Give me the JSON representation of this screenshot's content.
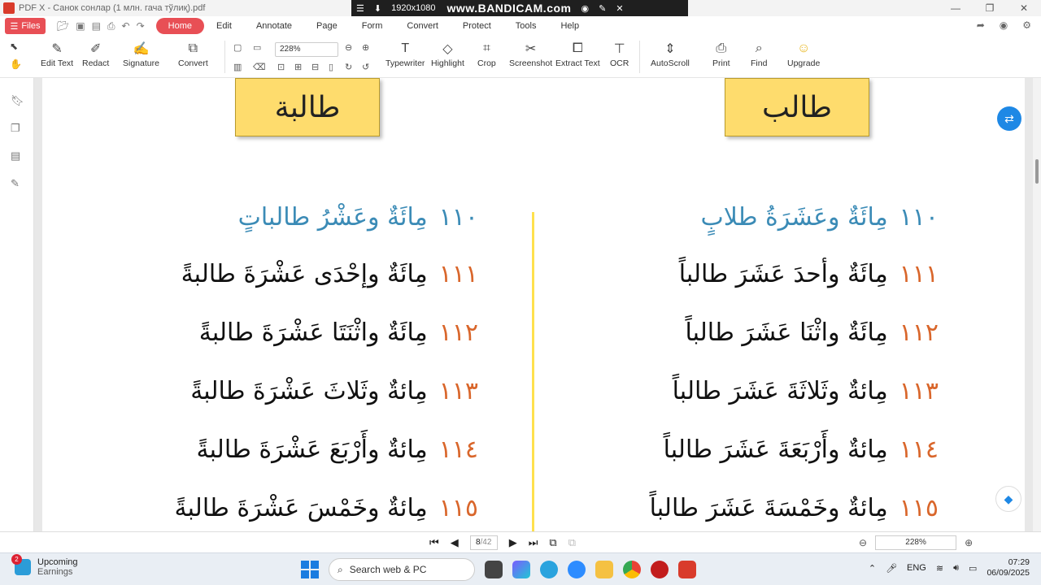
{
  "window": {
    "title": "PDF X - Санок сонлар (1 млн. гача тўлиқ).pdf"
  },
  "recorder": {
    "resolution": "1920x1080",
    "brand": "www.BANDICAM.com"
  },
  "menubar": {
    "files_label": "Files",
    "items": [
      "Home",
      "Edit",
      "Annotate",
      "Page",
      "Form",
      "Convert",
      "Protect",
      "Tools",
      "Help"
    ]
  },
  "toolbar": {
    "zoom": "228%",
    "tools": [
      "Edit Text",
      "Redact",
      "Signature",
      "Convert",
      "Typewriter",
      "Highlight",
      "Crop",
      "Screenshot",
      "Extract Text",
      "OCR",
      "AutoScroll",
      "Print",
      "Find",
      "Upgrade"
    ]
  },
  "document": {
    "left_title": "طالبة",
    "right_title": "طالب",
    "left_header": {
      "num": "١١٠",
      "text": "مِائَةٌ وعَشْرُ طالباتٍ"
    },
    "right_header": {
      "num": "١١٠",
      "text": "مِائَةٌ وعَشَرَةُ طلابٍ"
    },
    "left_lines": [
      {
        "num": "١١١",
        "text": "مِائَةٌ وإحْدَى عَشْرَةَ طالبةً"
      },
      {
        "num": "١١٢",
        "text": "مِائَةٌ واثْنَتَا عَشْرَةَ طالبةً"
      },
      {
        "num": "١١٣",
        "text": "مِائةٌ وثَلاثَ عَشْرَةَ طالبةً"
      },
      {
        "num": "١١٤",
        "text": "مِائةٌ وأَرْبَعَ عَشْرَةَ طالبةً"
      },
      {
        "num": "١١٥",
        "text": "مِائةٌ وخَمْسَ عَشْرَةَ طالبةً"
      }
    ],
    "right_lines": [
      {
        "num": "١١١",
        "text": "مِائَةٌ وأحدَ عَشَرَ طالباً"
      },
      {
        "num": "١١٢",
        "text": "مِائَةٌ واثْنَا عَشَرَ طالباً"
      },
      {
        "num": "١١٣",
        "text": "مِائةٌ وثَلاثَةَ عَشَرَ طالباً"
      },
      {
        "num": "١١٤",
        "text": "مِائةٌ وأَرْبَعَةَ عَشَرَ طالباً"
      },
      {
        "num": "١١٥",
        "text": "مِائةٌ وخَمْسَةَ عَشَرَ طالباً"
      }
    ]
  },
  "statusbar": {
    "page_current": "8",
    "page_total": "/42",
    "zoom": "228%"
  },
  "taskbar": {
    "weather_title": "Upcoming",
    "weather_sub": "Earnings",
    "weather_badge": "2",
    "search_placeholder": "Search web & PC",
    "lang": "ENG",
    "time": "07:29",
    "date": "06/09/2025"
  },
  "colors": {
    "accent": "#e84f55",
    "label_bg": "#fedc6d",
    "header_blue": "#3b8bb6",
    "number_orange": "#d9662b"
  }
}
